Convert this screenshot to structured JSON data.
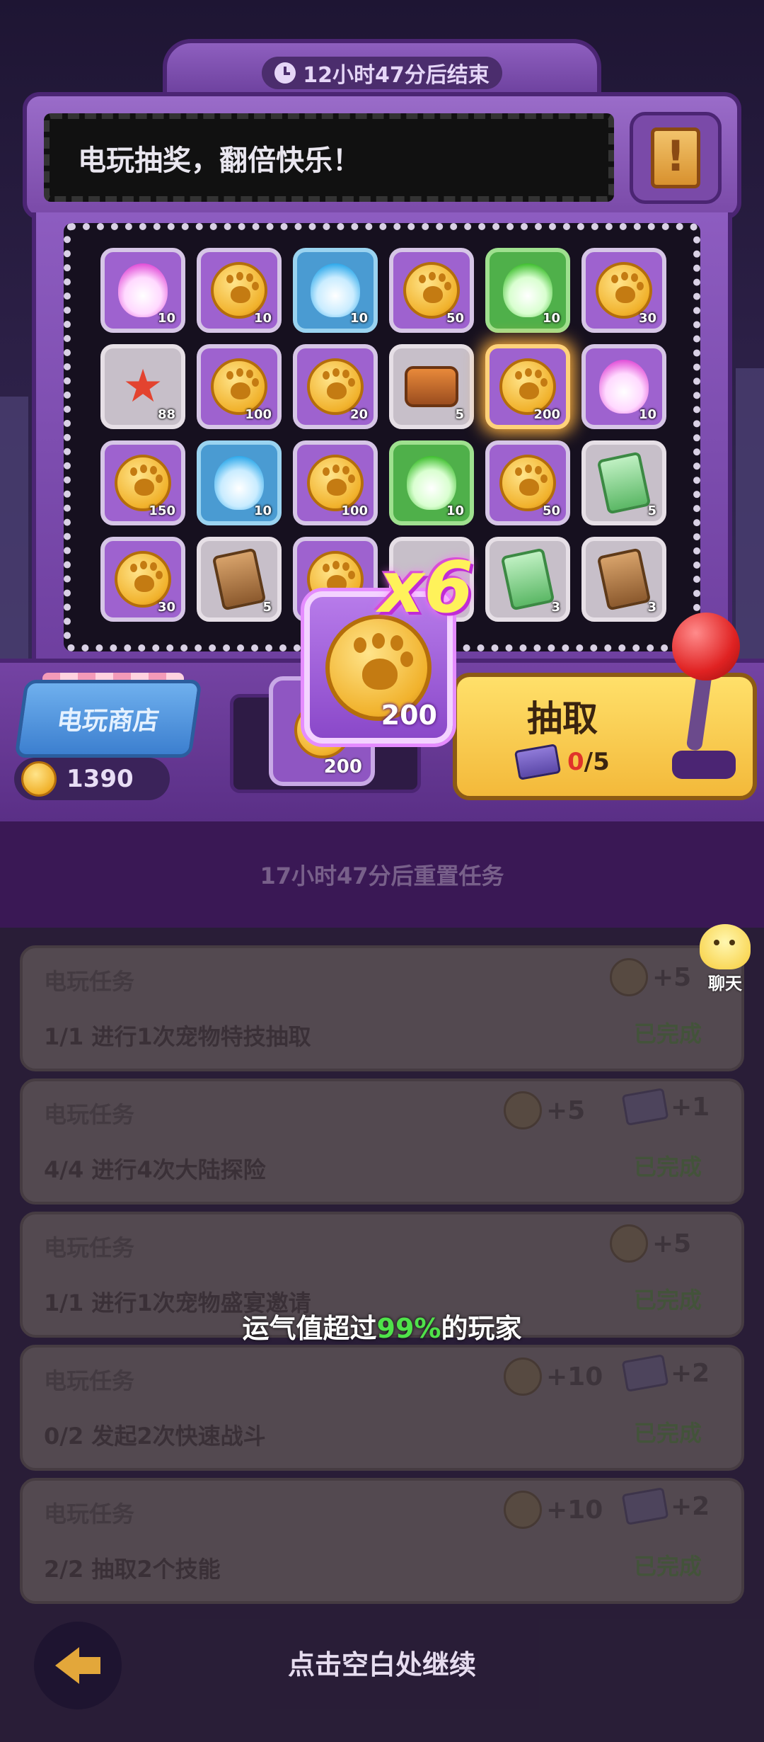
{
  "header": {
    "timer_text": "12小时47分后结束",
    "marquee_text": "电玩抽奖，翻倍快乐！",
    "info_icon": "scroll-info-icon"
  },
  "grid": {
    "cells": [
      {
        "item": "pink-paw-flame",
        "qty": "10",
        "style": "purple"
      },
      {
        "item": "coin",
        "qty": "10",
        "style": "purple"
      },
      {
        "item": "blue-paw-flame",
        "qty": "10",
        "style": "blue"
      },
      {
        "item": "coin",
        "qty": "50",
        "style": "purple"
      },
      {
        "item": "green-paw-flame",
        "qty": "10",
        "style": "green"
      },
      {
        "item": "coin",
        "qty": "30",
        "style": "purple"
      },
      {
        "item": "starfish",
        "qty": "88",
        "style": "gray"
      },
      {
        "item": "coin",
        "qty": "100",
        "style": "purple"
      },
      {
        "item": "coin",
        "qty": "20",
        "style": "purple"
      },
      {
        "item": "food-box",
        "qty": "5",
        "style": "gray"
      },
      {
        "item": "coin",
        "qty": "200",
        "style": "purple",
        "highlight": true
      },
      {
        "item": "pink-paw-flame",
        "qty": "10",
        "style": "purple"
      },
      {
        "item": "coin",
        "qty": "150",
        "style": "purple"
      },
      {
        "item": "blue-paw-flame",
        "qty": "10",
        "style": "blue"
      },
      {
        "item": "coin",
        "qty": "100",
        "style": "purple"
      },
      {
        "item": "green-paw-flame",
        "qty": "10",
        "style": "green"
      },
      {
        "item": "coin",
        "qty": "50",
        "style": "purple"
      },
      {
        "item": "green-ticket",
        "qty": "5",
        "style": "gray"
      },
      {
        "item": "coin",
        "qty": "30",
        "style": "purple"
      },
      {
        "item": "brown-ticket",
        "qty": "5",
        "style": "gray"
      },
      {
        "item": "coin",
        "qty": "",
        "style": "purple"
      },
      {
        "item": "hidden",
        "qty": "",
        "style": "gray"
      },
      {
        "item": "green-ticket",
        "qty": "3",
        "style": "gray"
      },
      {
        "item": "brown-ticket",
        "qty": "3",
        "style": "gray"
      }
    ]
  },
  "shop": {
    "label": "电玩商店",
    "balance": "1390"
  },
  "slot": {
    "qty": "200"
  },
  "draw": {
    "label": "抽取",
    "used": "0",
    "total": "/5"
  },
  "reward": {
    "qty": "200",
    "multiplier": "x6"
  },
  "tasks": {
    "reset_text": "17小时47分后重置任务",
    "items": [
      {
        "title": "电玩任务",
        "progress": "1/1",
        "desc": "进行1次宠物特技抽取",
        "status": "已完成",
        "coin_reward": "+5",
        "ticket_reward": ""
      },
      {
        "title": "电玩任务",
        "progress": "4/4",
        "desc": "进行4次大陆探险",
        "status": "已完成",
        "coin_reward": "+5",
        "ticket_reward": "+1"
      },
      {
        "title": "电玩任务",
        "progress": "1/1",
        "desc": "进行1次宠物盛宴邀请",
        "status": "已完成",
        "coin_reward": "+5",
        "ticket_reward": ""
      },
      {
        "title": "电玩任务",
        "progress": "0/2",
        "desc": "发起2次快速战斗",
        "status": "已完成",
        "coin_reward": "+10",
        "ticket_reward": "+2"
      },
      {
        "title": "电玩任务",
        "progress": "2/2",
        "desc": "抽取2个技能",
        "status": "已完成",
        "coin_reward": "+10",
        "ticket_reward": "+2"
      }
    ]
  },
  "overlay": {
    "luck_prefix": "运气值超过",
    "luck_pct": "99%",
    "luck_suffix": "的玩家",
    "continue_text": "点击空白处继续",
    "chat_label": "聊天"
  },
  "colors": {
    "accent_purple": "#5a2383",
    "highlight_gold": "#ffb23f",
    "luck_green": "#4fe24a"
  }
}
